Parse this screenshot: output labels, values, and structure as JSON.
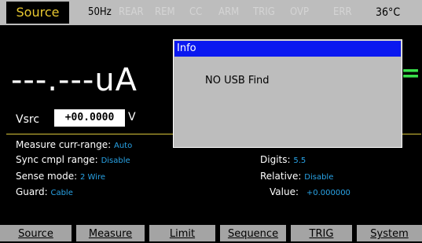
{
  "status_bar": {
    "mode": "Source",
    "indicators": [
      {
        "label": "50Hz",
        "active": true
      },
      {
        "label": "REAR",
        "active": false
      },
      {
        "label": "REM",
        "active": false
      },
      {
        "label": "CC",
        "active": false
      },
      {
        "label": "ARM",
        "active": false
      },
      {
        "label": "TRIG",
        "active": false
      },
      {
        "label": "OVP",
        "active": false
      },
      {
        "label": "ERR",
        "active": false
      }
    ],
    "temperature": "36°C"
  },
  "readout": {
    "value": "---.---uA",
    "aux": "="
  },
  "source": {
    "label": "Vsrc",
    "value": "+00.0000",
    "unit": "V"
  },
  "settings_left": [
    {
      "label": "Measure curr-range:",
      "value": "Auto"
    },
    {
      "label": "Sync cmpl range:",
      "value": "Disable"
    },
    {
      "label": "Sense mode:",
      "value": "2 Wire"
    },
    {
      "label": "Guard:",
      "value": "Cable"
    }
  ],
  "settings_right": [
    {
      "label": "Digits:",
      "value": "5.5"
    },
    {
      "label": "Relative:",
      "value": "Disable"
    },
    {
      "label": "Value:",
      "value": "+0.000000"
    }
  ],
  "softkeys": [
    "Source",
    "Measure",
    "Limit",
    "Sequence",
    "TRIG",
    "System"
  ],
  "dialog": {
    "title": "Info",
    "message": "NO USB Find"
  },
  "colors": {
    "accent_yellow": "#e8c830",
    "value_blue": "#29a3e6",
    "dialog_title_blue": "#0a18f0",
    "status_gray": "#bdbdbd"
  }
}
